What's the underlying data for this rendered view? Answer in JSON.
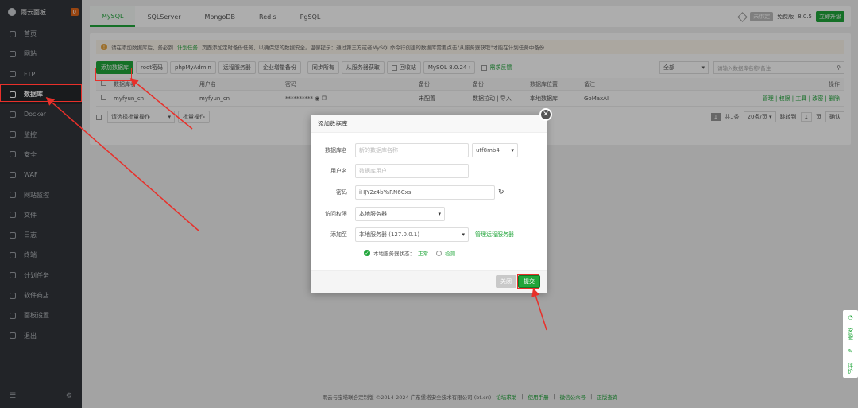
{
  "sidebar": {
    "brand": "雨云面板",
    "badge": "0",
    "items": [
      {
        "label": "首页"
      },
      {
        "label": "网站"
      },
      {
        "label": "FTP"
      },
      {
        "label": "数据库"
      },
      {
        "label": "Docker"
      },
      {
        "label": "监控"
      },
      {
        "label": "安全"
      },
      {
        "label": "WAF"
      },
      {
        "label": "网站监控"
      },
      {
        "label": "文件"
      },
      {
        "label": "日志"
      },
      {
        "label": "终端"
      },
      {
        "label": "计划任务"
      },
      {
        "label": "软件商店"
      },
      {
        "label": "面板设置"
      },
      {
        "label": "退出"
      }
    ]
  },
  "tabs": [
    "MySQL",
    "SQLServer",
    "MongoDB",
    "Redis",
    "PgSQL"
  ],
  "topbar": {
    "status": "未绑定",
    "edition": "免费版",
    "version": "8.0.5",
    "upgrade": "立即升级"
  },
  "alert": {
    "text1": "请在添加数据库后，务必到",
    "link": "计划任务",
    "text2": "页面添加定时备份任务，以确保您的数据安全。温馨提示：通过第三方或者MySQL命令行创建的数据库需要点击\"从服务器获取\"才能在计划任务中备份"
  },
  "toolbar": {
    "add_db": "添加数据库",
    "root_pwd": "root密码",
    "phpmyadmin": "phpMyAdmin",
    "remote_server": "远程服务器",
    "enterprise_backup": "企业增量备份",
    "sync_all": "同步所有",
    "fetch_from_server": "从服务器获取",
    "recycle_bin": "回收站",
    "mysql_version": "MySQL 8.0.24",
    "request_feedback": "需求反馈",
    "filter": "全部",
    "search_placeholder": "请输入数据库名称/备注"
  },
  "table": {
    "headers": {
      "name": "数据库名",
      "user": "用户名",
      "password": "密码",
      "backup": "备份",
      "backup_col": "备份",
      "location": "数据库位置",
      "note": "备注",
      "op": "操作"
    },
    "rows": [
      {
        "name": "myfyun_cn",
        "user": "myfyun_cn",
        "password": "**********",
        "backup": "未配置",
        "backup_action": "数据拉动 | 导入",
        "location": "本地数据库",
        "note": "GoMaxAI",
        "ops": "管理 | 权限 | 工具 | 改密 | 删除"
      }
    ]
  },
  "pager": {
    "batch": "请选择批量操作",
    "batch_btn": "批量操作",
    "page": "1",
    "total": "共1条",
    "per_page": "20条/页",
    "jump": "跳转到",
    "page_input": "1",
    "page_unit": "页",
    "confirm": "确认"
  },
  "dialog": {
    "title": "添加数据库",
    "db_name_label": "数据库名",
    "db_name_placeholder": "新的数据库名称",
    "charset": "utf8mb4",
    "user_label": "用户名",
    "user_placeholder": "数据库用户",
    "password_label": "密码",
    "password_value": "iHJY2z4bYaRN6Cxs",
    "access_label": "访问权限",
    "access_value": "本地服务器",
    "add_to_label": "添加至",
    "add_to_value": "本地服务器 (127.0.0.1)",
    "manage_remote": "管理远程服务器",
    "status_label": "本地服务器状态：",
    "status_value": "正常",
    "check": "检测",
    "cancel": "关闭",
    "submit": "提交"
  },
  "float": {
    "service": "客服",
    "review": "评价"
  },
  "footer": {
    "copyright": "雨云与宝塔联合定制版 ©2014-2024 广东堡塔安全技术有限公司 (bt.cn)",
    "links": [
      "论坛求助",
      "使用手册",
      "微信公众号",
      "正版查询"
    ]
  }
}
